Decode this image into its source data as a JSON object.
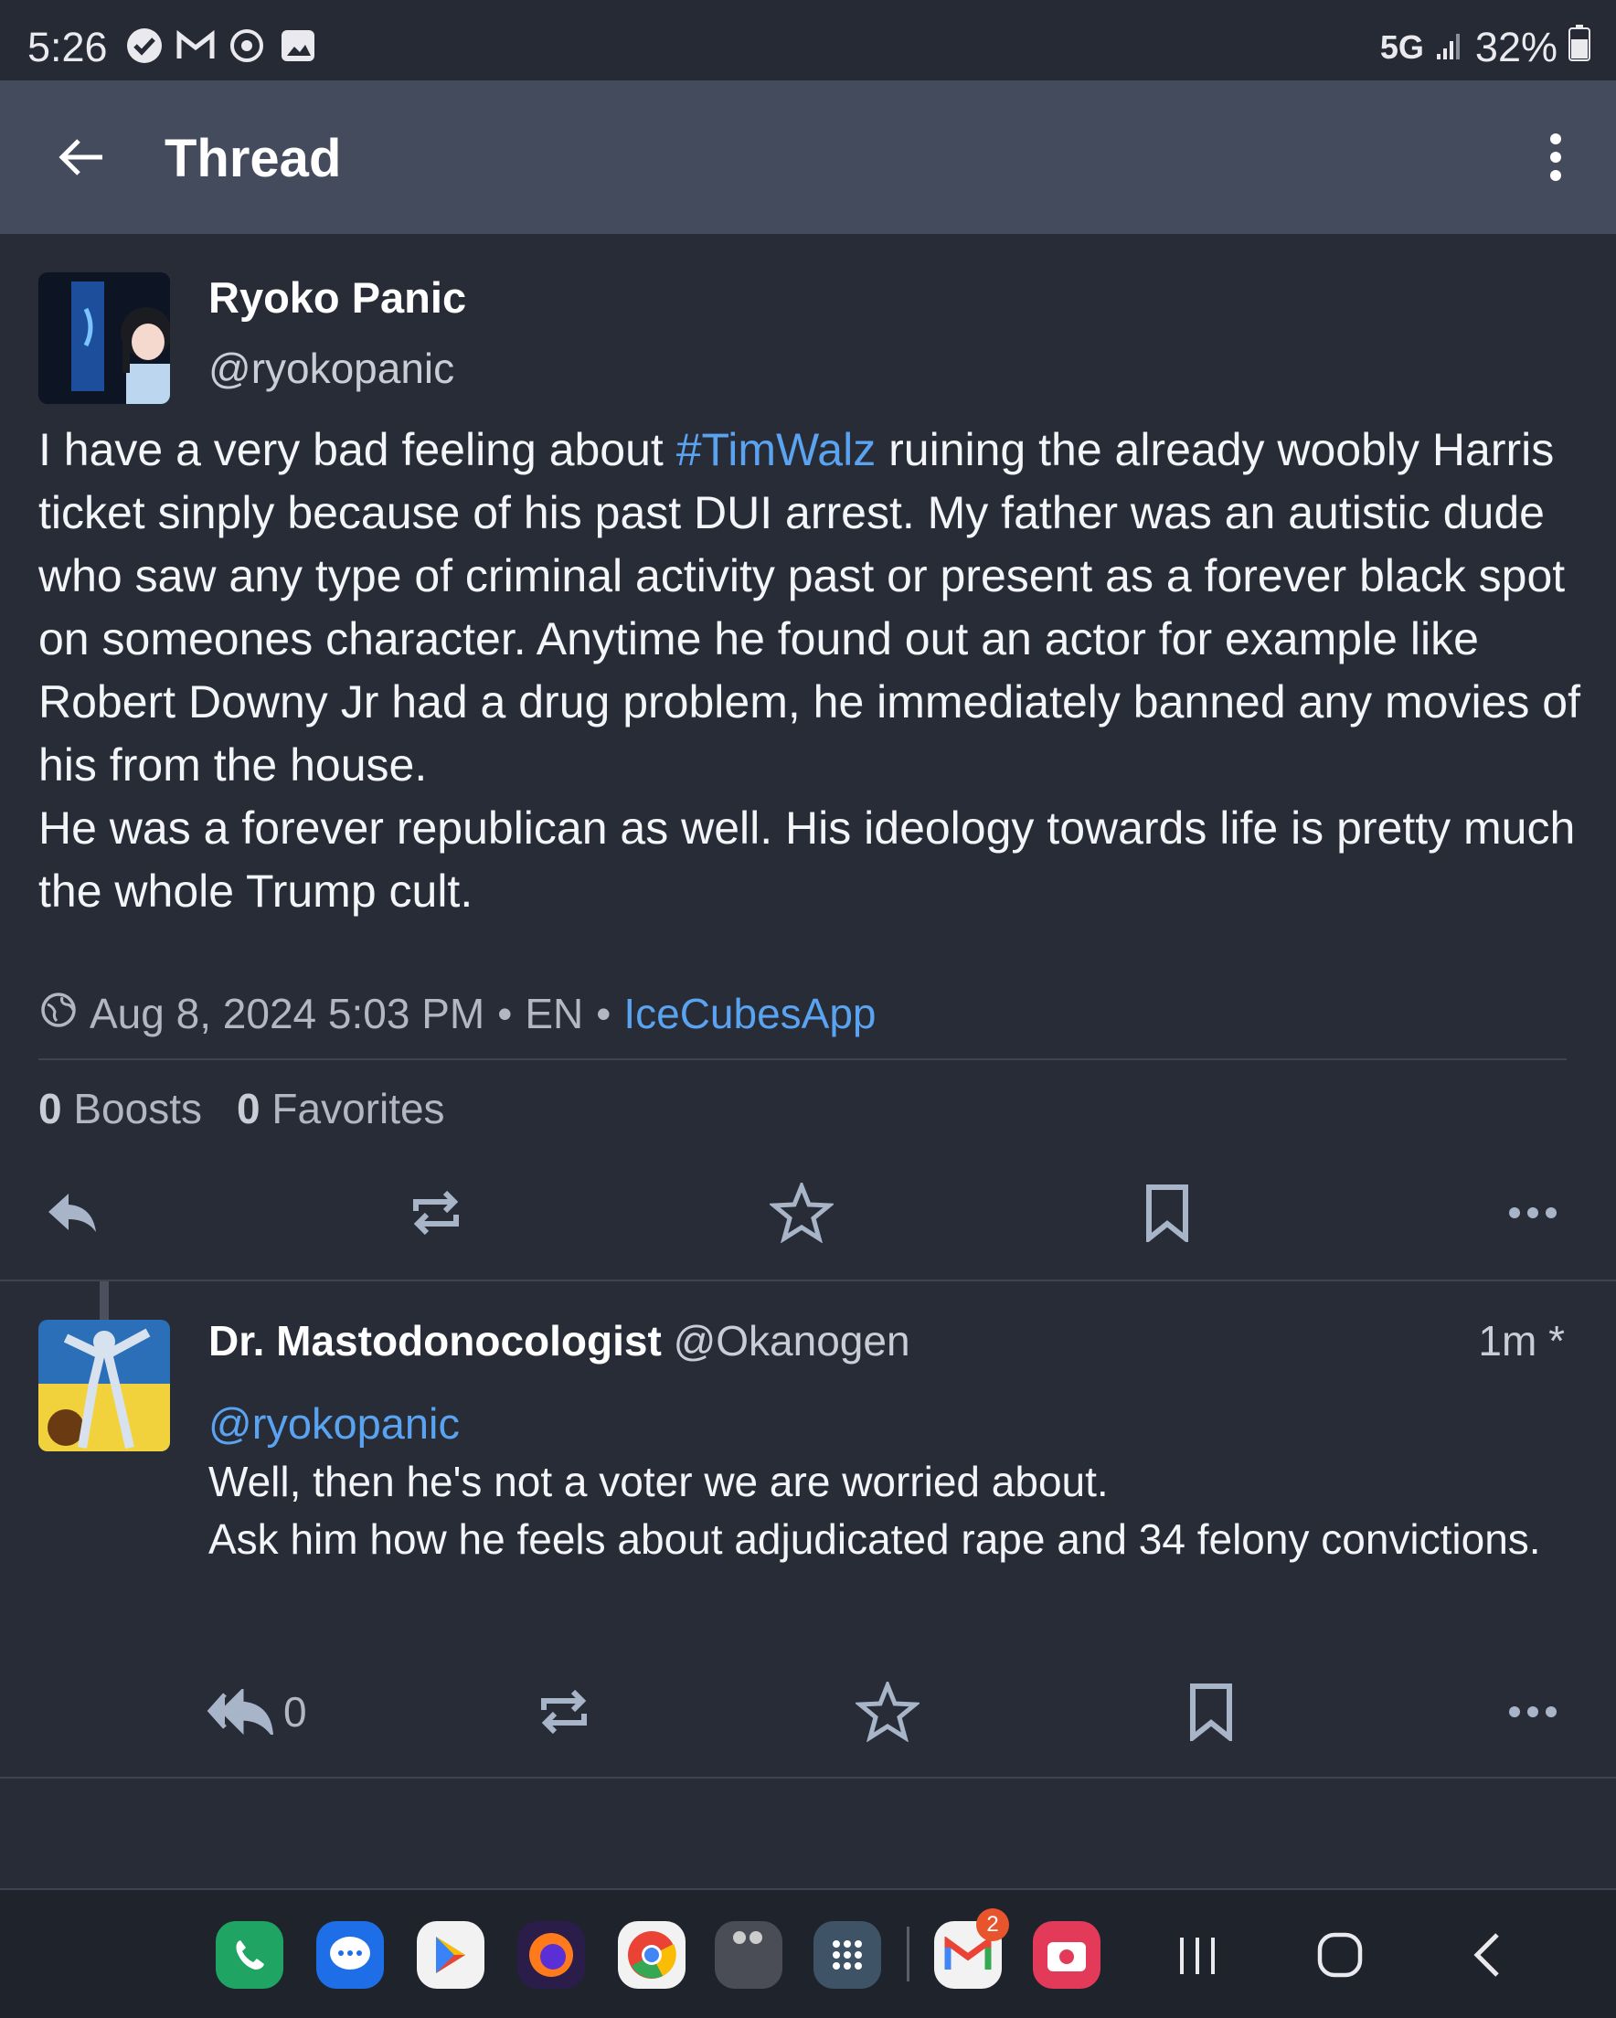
{
  "status_bar": {
    "time": "5:26",
    "network": "5G",
    "battery": "32%"
  },
  "app_bar": {
    "title": "Thread"
  },
  "post": {
    "display_name": "Ryoko Panic",
    "handle": "@ryokopanic",
    "body_line1_before": "I have a very bad feeling about ",
    "hashtag": "#TimWalz",
    "body_line1_after": " ruining the already woobly Harris ticket sinply because of his past DUI arrest. My father was an autistic dude who saw any type of criminal activity past or present as a forever black spot on someones character. Anytime he found out an actor for example like Robert Downy Jr had a drug problem, he immediately banned any movies of his from the house.",
    "body_paragraph2": "He was a forever republican as well. His ideology towards life is pretty much the whole Trump cult.",
    "timestamp": "Aug 8, 2024 5:03 PM",
    "separator": "•",
    "language": "EN",
    "client_app": "IceCubesApp",
    "boosts_count": "0",
    "boosts_label": "Boosts",
    "favorites_count": "0",
    "favorites_label": "Favorites"
  },
  "reply": {
    "display_name": "Dr. Mastodonocologist",
    "handle": "@Okanogen",
    "time": "1m *",
    "mention": "@ryokopanic",
    "line1": "Well, then he's not a voter we are worried about.",
    "line2": "Ask him how he feels about adjudicated rape and 34 felony convictions.",
    "reply_count": "0"
  },
  "dock": {
    "apps": [
      "phone-icon",
      "messages-icon",
      "play-store-icon",
      "firefox-icon",
      "chrome-icon",
      "camera-app-icon",
      "app-drawer-icon",
      "gmail-icon",
      "screen-recorder-icon"
    ],
    "gmail_badge": "2"
  },
  "colors": {
    "background": "#282c37",
    "appbar": "#444b5d",
    "link": "#5aa3f0"
  }
}
